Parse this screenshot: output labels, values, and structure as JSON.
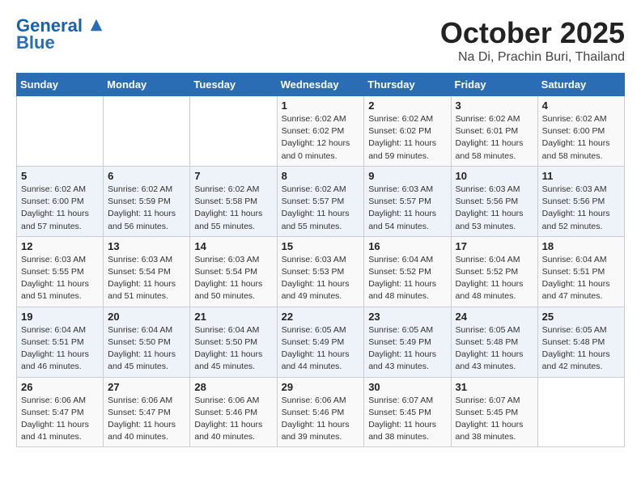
{
  "header": {
    "logo_line1": "General",
    "logo_line2": "Blue",
    "month": "October 2025",
    "location": "Na Di, Prachin Buri, Thailand"
  },
  "days_of_week": [
    "Sunday",
    "Monday",
    "Tuesday",
    "Wednesday",
    "Thursday",
    "Friday",
    "Saturday"
  ],
  "weeks": [
    [
      {
        "day": "",
        "info": ""
      },
      {
        "day": "",
        "info": ""
      },
      {
        "day": "",
        "info": ""
      },
      {
        "day": "1",
        "info": "Sunrise: 6:02 AM\nSunset: 6:02 PM\nDaylight: 12 hours\nand 0 minutes."
      },
      {
        "day": "2",
        "info": "Sunrise: 6:02 AM\nSunset: 6:02 PM\nDaylight: 11 hours\nand 59 minutes."
      },
      {
        "day": "3",
        "info": "Sunrise: 6:02 AM\nSunset: 6:01 PM\nDaylight: 11 hours\nand 58 minutes."
      },
      {
        "day": "4",
        "info": "Sunrise: 6:02 AM\nSunset: 6:00 PM\nDaylight: 11 hours\nand 58 minutes."
      }
    ],
    [
      {
        "day": "5",
        "info": "Sunrise: 6:02 AM\nSunset: 6:00 PM\nDaylight: 11 hours\nand 57 minutes."
      },
      {
        "day": "6",
        "info": "Sunrise: 6:02 AM\nSunset: 5:59 PM\nDaylight: 11 hours\nand 56 minutes."
      },
      {
        "day": "7",
        "info": "Sunrise: 6:02 AM\nSunset: 5:58 PM\nDaylight: 11 hours\nand 55 minutes."
      },
      {
        "day": "8",
        "info": "Sunrise: 6:02 AM\nSunset: 5:57 PM\nDaylight: 11 hours\nand 55 minutes."
      },
      {
        "day": "9",
        "info": "Sunrise: 6:03 AM\nSunset: 5:57 PM\nDaylight: 11 hours\nand 54 minutes."
      },
      {
        "day": "10",
        "info": "Sunrise: 6:03 AM\nSunset: 5:56 PM\nDaylight: 11 hours\nand 53 minutes."
      },
      {
        "day": "11",
        "info": "Sunrise: 6:03 AM\nSunset: 5:56 PM\nDaylight: 11 hours\nand 52 minutes."
      }
    ],
    [
      {
        "day": "12",
        "info": "Sunrise: 6:03 AM\nSunset: 5:55 PM\nDaylight: 11 hours\nand 51 minutes."
      },
      {
        "day": "13",
        "info": "Sunrise: 6:03 AM\nSunset: 5:54 PM\nDaylight: 11 hours\nand 51 minutes."
      },
      {
        "day": "14",
        "info": "Sunrise: 6:03 AM\nSunset: 5:54 PM\nDaylight: 11 hours\nand 50 minutes."
      },
      {
        "day": "15",
        "info": "Sunrise: 6:03 AM\nSunset: 5:53 PM\nDaylight: 11 hours\nand 49 minutes."
      },
      {
        "day": "16",
        "info": "Sunrise: 6:04 AM\nSunset: 5:52 PM\nDaylight: 11 hours\nand 48 minutes."
      },
      {
        "day": "17",
        "info": "Sunrise: 6:04 AM\nSunset: 5:52 PM\nDaylight: 11 hours\nand 48 minutes."
      },
      {
        "day": "18",
        "info": "Sunrise: 6:04 AM\nSunset: 5:51 PM\nDaylight: 11 hours\nand 47 minutes."
      }
    ],
    [
      {
        "day": "19",
        "info": "Sunrise: 6:04 AM\nSunset: 5:51 PM\nDaylight: 11 hours\nand 46 minutes."
      },
      {
        "day": "20",
        "info": "Sunrise: 6:04 AM\nSunset: 5:50 PM\nDaylight: 11 hours\nand 45 minutes."
      },
      {
        "day": "21",
        "info": "Sunrise: 6:04 AM\nSunset: 5:50 PM\nDaylight: 11 hours\nand 45 minutes."
      },
      {
        "day": "22",
        "info": "Sunrise: 6:05 AM\nSunset: 5:49 PM\nDaylight: 11 hours\nand 44 minutes."
      },
      {
        "day": "23",
        "info": "Sunrise: 6:05 AM\nSunset: 5:49 PM\nDaylight: 11 hours\nand 43 minutes."
      },
      {
        "day": "24",
        "info": "Sunrise: 6:05 AM\nSunset: 5:48 PM\nDaylight: 11 hours\nand 43 minutes."
      },
      {
        "day": "25",
        "info": "Sunrise: 6:05 AM\nSunset: 5:48 PM\nDaylight: 11 hours\nand 42 minutes."
      }
    ],
    [
      {
        "day": "26",
        "info": "Sunrise: 6:06 AM\nSunset: 5:47 PM\nDaylight: 11 hours\nand 41 minutes."
      },
      {
        "day": "27",
        "info": "Sunrise: 6:06 AM\nSunset: 5:47 PM\nDaylight: 11 hours\nand 40 minutes."
      },
      {
        "day": "28",
        "info": "Sunrise: 6:06 AM\nSunset: 5:46 PM\nDaylight: 11 hours\nand 40 minutes."
      },
      {
        "day": "29",
        "info": "Sunrise: 6:06 AM\nSunset: 5:46 PM\nDaylight: 11 hours\nand 39 minutes."
      },
      {
        "day": "30",
        "info": "Sunrise: 6:07 AM\nSunset: 5:45 PM\nDaylight: 11 hours\nand 38 minutes."
      },
      {
        "day": "31",
        "info": "Sunrise: 6:07 AM\nSunset: 5:45 PM\nDaylight: 11 hours\nand 38 minutes."
      },
      {
        "day": "",
        "info": ""
      }
    ]
  ]
}
